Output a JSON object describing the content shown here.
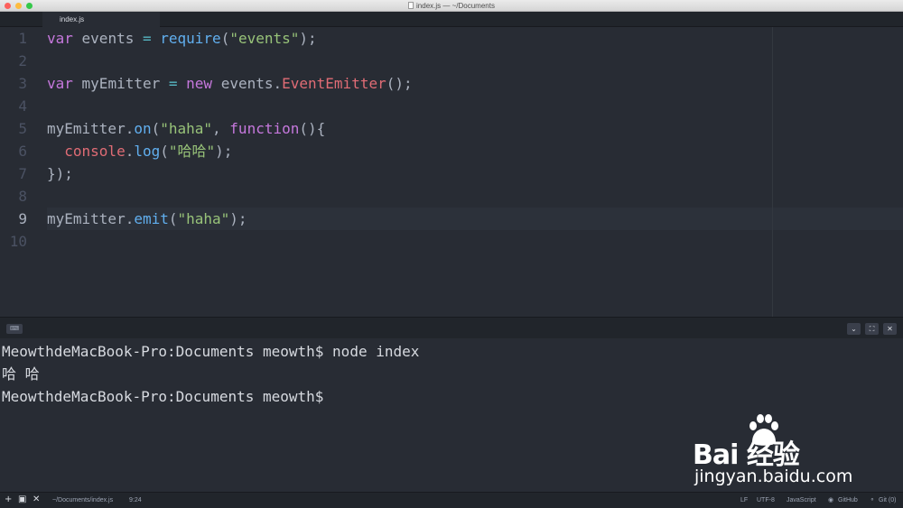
{
  "window": {
    "title": "index.js — ~/Documents"
  },
  "tabs": [
    {
      "label": "index.js"
    }
  ],
  "editor": {
    "line_numbers": [
      "1",
      "2",
      "3",
      "4",
      "5",
      "6",
      "7",
      "8",
      "9",
      "10"
    ],
    "lines": [
      [
        {
          "t": "var",
          "c": "kw"
        },
        {
          "t": " events "
        },
        {
          "t": "=",
          "c": "op"
        },
        {
          "t": " "
        },
        {
          "t": "require",
          "c": "fn"
        },
        {
          "t": "("
        },
        {
          "t": "\"events\"",
          "c": "str"
        },
        {
          "t": ");"
        }
      ],
      [],
      [
        {
          "t": "var",
          "c": "kw"
        },
        {
          "t": " myEmitter "
        },
        {
          "t": "=",
          "c": "op"
        },
        {
          "t": " "
        },
        {
          "t": "new",
          "c": "kw"
        },
        {
          "t": " events."
        },
        {
          "t": "EventEmitter",
          "c": "cls"
        },
        {
          "t": "();"
        }
      ],
      [],
      [
        {
          "t": "myEmitter."
        },
        {
          "t": "on",
          "c": "fn"
        },
        {
          "t": "("
        },
        {
          "t": "\"haha\"",
          "c": "str"
        },
        {
          "t": ", "
        },
        {
          "t": "function",
          "c": "kw"
        },
        {
          "t": "(){"
        }
      ],
      [
        {
          "t": "  "
        },
        {
          "t": "console",
          "c": "cls"
        },
        {
          "t": "."
        },
        {
          "t": "log",
          "c": "fn"
        },
        {
          "t": "("
        },
        {
          "t": "\"哈哈\"",
          "c": "str"
        },
        {
          "t": ");"
        }
      ],
      [
        {
          "t": "});"
        }
      ],
      [],
      [
        {
          "t": "myEmitter."
        },
        {
          "t": "emit",
          "c": "fn"
        },
        {
          "t": "("
        },
        {
          "t": "\"haha\"",
          "c": "str"
        },
        {
          "t": ");"
        }
      ],
      []
    ]
  },
  "terminal": {
    "icon": "terminal-icon",
    "buttons": {
      "collapse": "⌄",
      "maximize": "⛶",
      "close": "✕"
    },
    "lines": [
      "MeowthdeMacBook-Pro:Documents meowth$ node index",
      "哈 哈",
      "MeowthdeMacBook-Pro:Documents meowth$"
    ]
  },
  "watermark": {
    "logo": "Bai  经验",
    "url": "jingyan.baidu.com"
  },
  "statusbar": {
    "add_icon": "+",
    "terminal_icon": "▣",
    "close_icon": "✕",
    "file_path": "~/Documents/index.js",
    "cursor_position": "9:24",
    "line_ending": "LF",
    "encoding": "UTF-8",
    "grammar": "JavaScript",
    "github": "GitHub",
    "git": "Git (0)"
  },
  "colors": {
    "accent": "#61afef",
    "keyword": "#c678dd",
    "string": "#98c379",
    "class": "#e06c75"
  }
}
